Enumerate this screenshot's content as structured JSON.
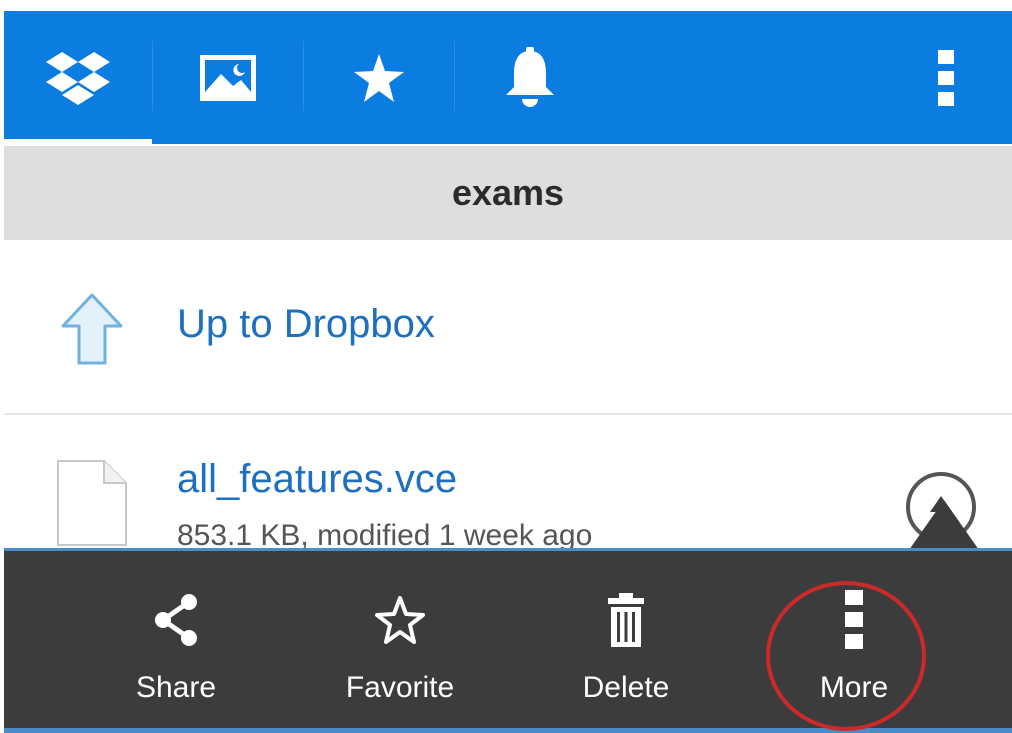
{
  "header": {
    "tabs": [
      {
        "icon": "dropbox-icon",
        "active": true
      },
      {
        "icon": "photos-icon",
        "active": false
      },
      {
        "icon": "star-icon",
        "active": false
      },
      {
        "icon": "bell-icon",
        "active": false
      }
    ],
    "overflow_icon": "vertical-dots-icon",
    "accent_color": "#0b7de0"
  },
  "titlebar": {
    "title": "exams"
  },
  "list": {
    "up_row": {
      "label": "Up to Dropbox",
      "icon": "up-arrow-icon"
    },
    "files": [
      {
        "name": "all_features.vce",
        "meta": "853.1 KB, modified 1 week ago",
        "icon": "file-icon",
        "toggle_icon": "collapse-chevron-icon"
      }
    ]
  },
  "actions": {
    "share_label": "Share",
    "favorite_label": "Favorite",
    "delete_label": "Delete",
    "more_label": "More"
  },
  "colors": {
    "actionbar_bg": "#3c3c3c",
    "link_blue": "#1e6fc0",
    "highlight_red": "#cc2a2a"
  }
}
